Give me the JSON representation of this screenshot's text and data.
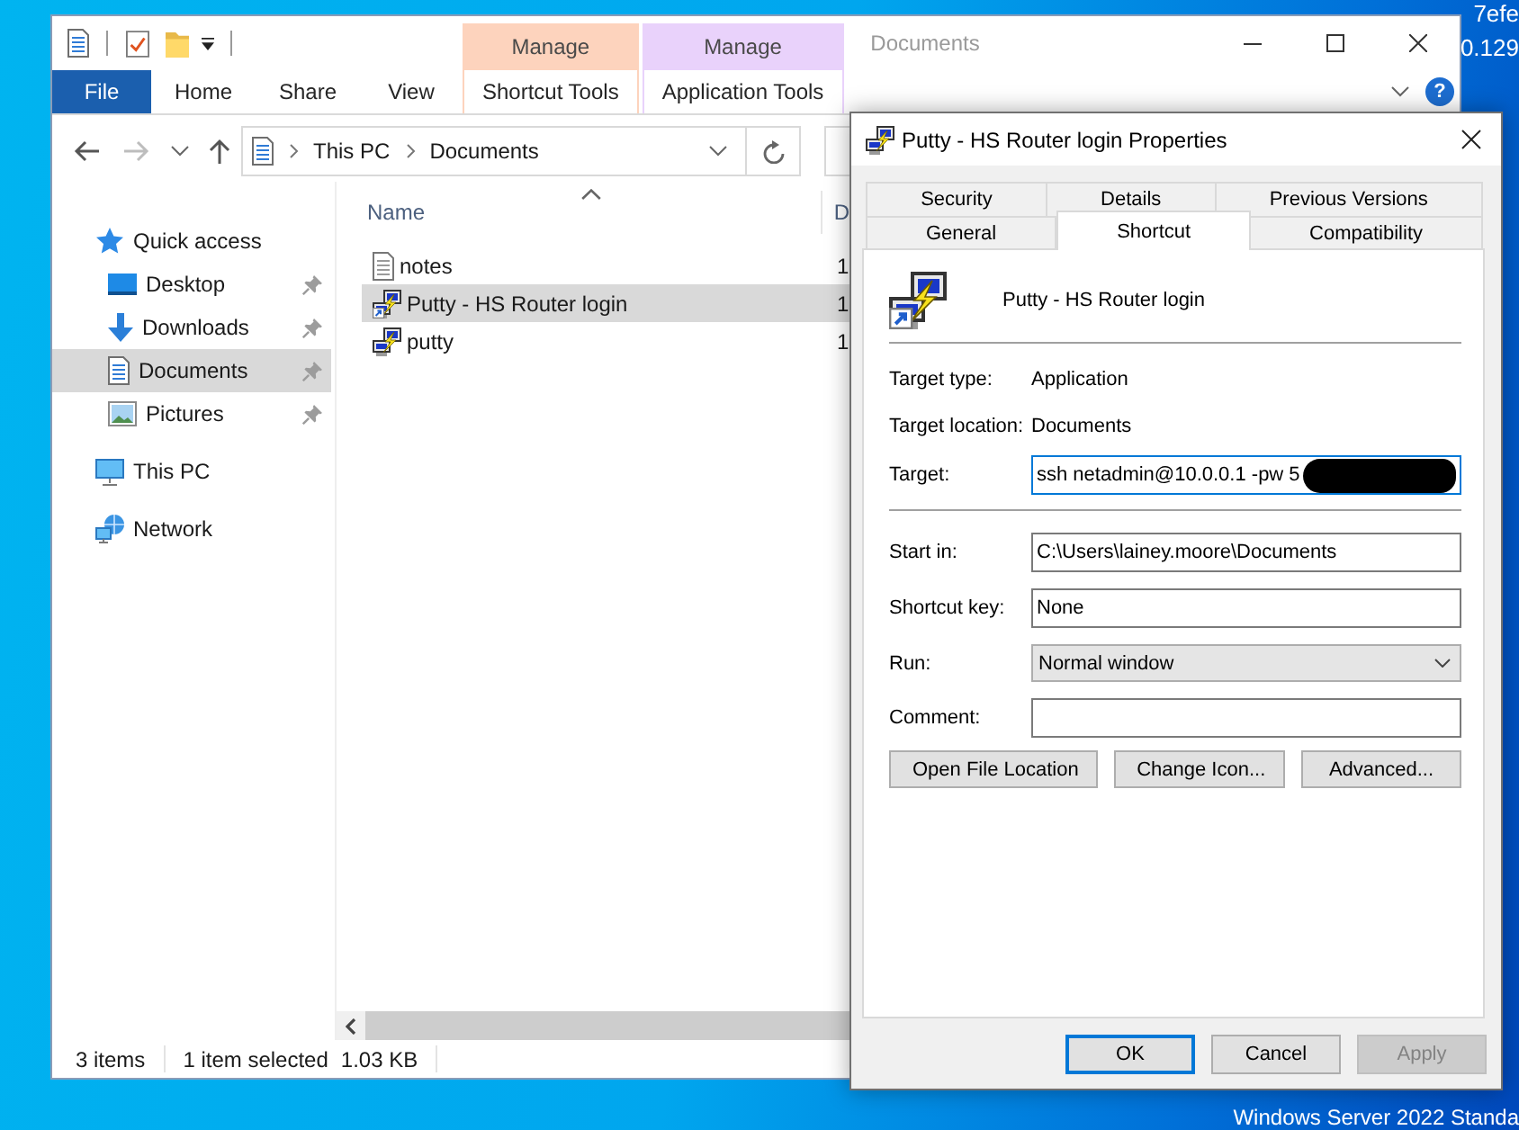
{
  "desktop": {
    "info_lines": [
      "7efe",
      "0.129"
    ],
    "edition": "Windows Server 2022 Standa"
  },
  "explorer": {
    "title": "Documents",
    "help": "?",
    "ribbon_tabs": [
      {
        "label": "File",
        "kind": "file"
      },
      {
        "label": "Home",
        "kind": "plain"
      },
      {
        "label": "Share",
        "kind": "plain"
      },
      {
        "label": "View",
        "kind": "plain"
      },
      {
        "label": "Shortcut Tools",
        "kind": "contextual",
        "header": "Manage",
        "color": "#fdd3bd"
      },
      {
        "label": "Application Tools",
        "kind": "contextual",
        "header": "Manage",
        "color": "#e9d2fb"
      }
    ],
    "address": {
      "path": [
        "This PC",
        "Documents"
      ]
    },
    "nav_pane": [
      {
        "label": "Quick access",
        "kind": "quick_access",
        "selected": false,
        "pinned": false,
        "children": [
          {
            "label": "Desktop",
            "kind": "desktop",
            "selected": false,
            "pinned": true
          },
          {
            "label": "Downloads",
            "kind": "downloads",
            "selected": false,
            "pinned": true
          },
          {
            "label": "Documents",
            "kind": "documents",
            "selected": true,
            "pinned": true
          },
          {
            "label": "Pictures",
            "kind": "pictures",
            "selected": false,
            "pinned": true
          }
        ]
      },
      {
        "label": "This PC",
        "kind": "this_pc",
        "selected": false,
        "pinned": false
      },
      {
        "label": "Network",
        "kind": "network",
        "selected": false,
        "pinned": false
      }
    ],
    "columns": [
      {
        "label": "Name",
        "sorted": true
      },
      {
        "label": "D",
        "sorted": false
      }
    ],
    "files": [
      {
        "name": "notes",
        "kind": "text",
        "column_2": "1",
        "selected": false
      },
      {
        "name": "Putty - HS Router login",
        "kind": "shortcut",
        "column_2": "1",
        "selected": true
      },
      {
        "name": "putty",
        "kind": "application",
        "column_2": "1",
        "selected": false
      }
    ],
    "status_bar": {
      "item_count": "3 items",
      "selection": "1 item selected",
      "selection_size": "1.03 KB"
    }
  },
  "dialog": {
    "title": "Putty - HS Router login Properties",
    "tab_rows": [
      [
        {
          "label": "Security",
          "selected": false
        },
        {
          "label": "Details",
          "selected": false
        },
        {
          "label": "Previous Versions",
          "selected": false
        }
      ],
      [
        {
          "label": "General",
          "selected": false
        },
        {
          "label": "Shortcut",
          "selected": true
        },
        {
          "label": "Compatibility",
          "selected": false
        }
      ]
    ],
    "shortcut_name": "Putty - HS Router login",
    "target_fields": [
      {
        "kind": "info",
        "label": "Target type:",
        "value": "Application"
      },
      {
        "kind": "info",
        "label": "Target location:",
        "value": "Documents"
      },
      {
        "kind": "text",
        "label": "Target:",
        "value": "ssh netadmin@10.0.0.1 -pw 5",
        "focused": true,
        "redacted": true
      }
    ],
    "option_fields": [
      {
        "kind": "text",
        "label": "Start in:",
        "value": "C:\\Users\\lainey.moore\\Documents",
        "focused": false,
        "redacted": false
      },
      {
        "kind": "text",
        "label": "Shortcut key:",
        "value": "None",
        "focused": false,
        "redacted": false
      },
      {
        "kind": "select",
        "label": "Run:",
        "value": "Normal window",
        "focused": false
      },
      {
        "kind": "text",
        "label": "Comment:",
        "focused": false,
        "redacted": false
      }
    ],
    "action_buttons": [
      "Open File Location",
      "Change Icon...",
      "Advanced..."
    ],
    "footer_buttons": [
      {
        "label": "OK",
        "default": true,
        "disabled": false
      },
      {
        "label": "Cancel",
        "default": false,
        "disabled": false
      },
      {
        "label": "Apply",
        "default": false,
        "disabled": true
      }
    ]
  }
}
